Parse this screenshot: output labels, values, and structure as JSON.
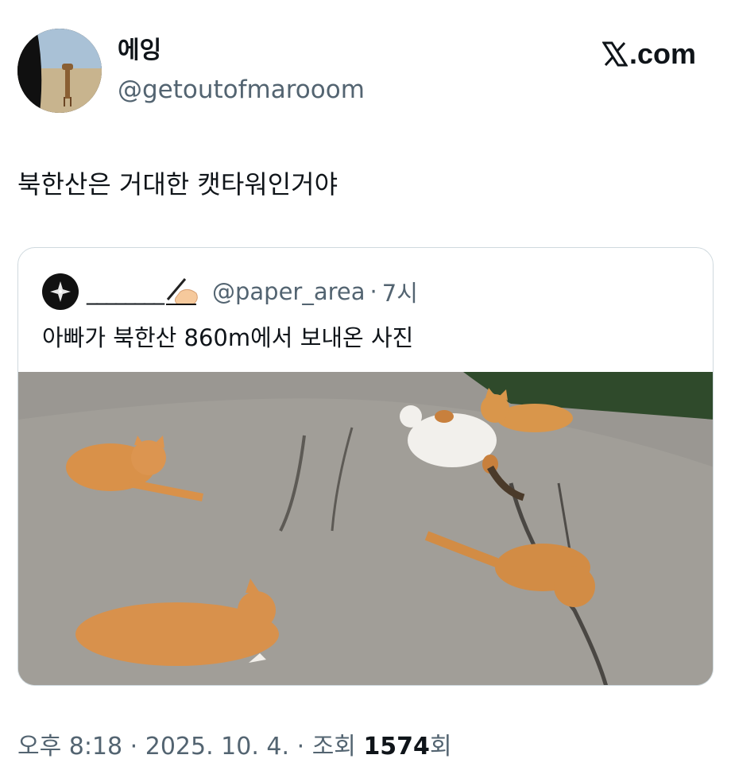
{
  "author": {
    "display_name": "에잉",
    "handle": "@getoutofmarooom",
    "avatar_icon": "giraffe-photo"
  },
  "site": {
    "logo_icon": "x-logo-icon",
    "logo_text": ".com"
  },
  "tweet": {
    "text": "북한산은 거대한 캣타워인거야"
  },
  "quoted_tweet": {
    "avatar_icon": "star-avatar-icon",
    "display_name": "________",
    "name_emoji": "writing-hand-icon",
    "handle": "@paper_area",
    "separator": "·",
    "time": "7시",
    "text": "아빠가 북한산 860m에서 보내온 사진",
    "photo_icon": "cats-on-rock-photo"
  },
  "meta": {
    "time": "오후 8:18",
    "sep1": "·",
    "date": "2025. 10. 4.",
    "sep2": "·",
    "views_label": "조회",
    "views_count": "1574",
    "views_suffix": "회"
  }
}
